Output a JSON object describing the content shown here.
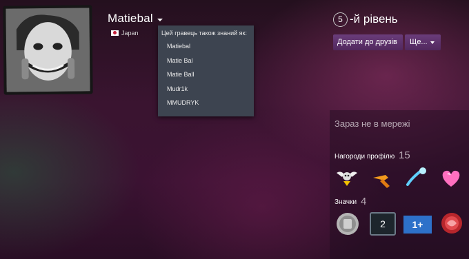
{
  "profile": {
    "name": "Matiebal",
    "location": "Japan",
    "level_number": "5",
    "level_suffix": "-й рівень",
    "status": "Зараз не в мережі"
  },
  "alias_popup": {
    "title": "Цей гравець також знаний як:",
    "aliases": [
      "Matiebal",
      "Matie Bal",
      "Matie Ball",
      "Mudr1k",
      "MMUDRYK"
    ]
  },
  "buttons": {
    "add_friend": "Додати до друзів",
    "more": "Ще..."
  },
  "awards": {
    "label": "Нагороди профілю",
    "count": "15"
  },
  "badges": {
    "label": "Значки",
    "count": "4",
    "items": [
      "2",
      "1+"
    ]
  },
  "colors": {
    "popup_bg": "#3d4450",
    "button_bg": "#5a2f69",
    "muted_text": "#b8aab5"
  }
}
